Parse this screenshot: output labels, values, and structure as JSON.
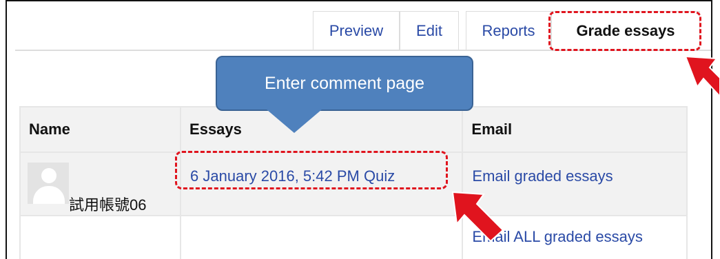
{
  "tabs": [
    {
      "label": "Preview",
      "active": false
    },
    {
      "label": "Edit",
      "active": false
    },
    {
      "label": "Reports",
      "active": false
    },
    {
      "label": "Grade essays",
      "active": true
    }
  ],
  "callout": {
    "text": "Enter comment page"
  },
  "table": {
    "headers": [
      "Name",
      "Essays",
      "Email"
    ],
    "rows": [
      {
        "name": "試用帳號06",
        "essay": "6 January 2016, 5:42 PM Quiz",
        "email": "Email graded essays"
      },
      {
        "name": "",
        "essay": "",
        "email": "Email ALL graded essays"
      }
    ]
  },
  "colors": {
    "link": "#2a4aa6",
    "highlight": "#e0141e",
    "callout": "#4f81bd",
    "header_bg": "#f2f2f2"
  }
}
